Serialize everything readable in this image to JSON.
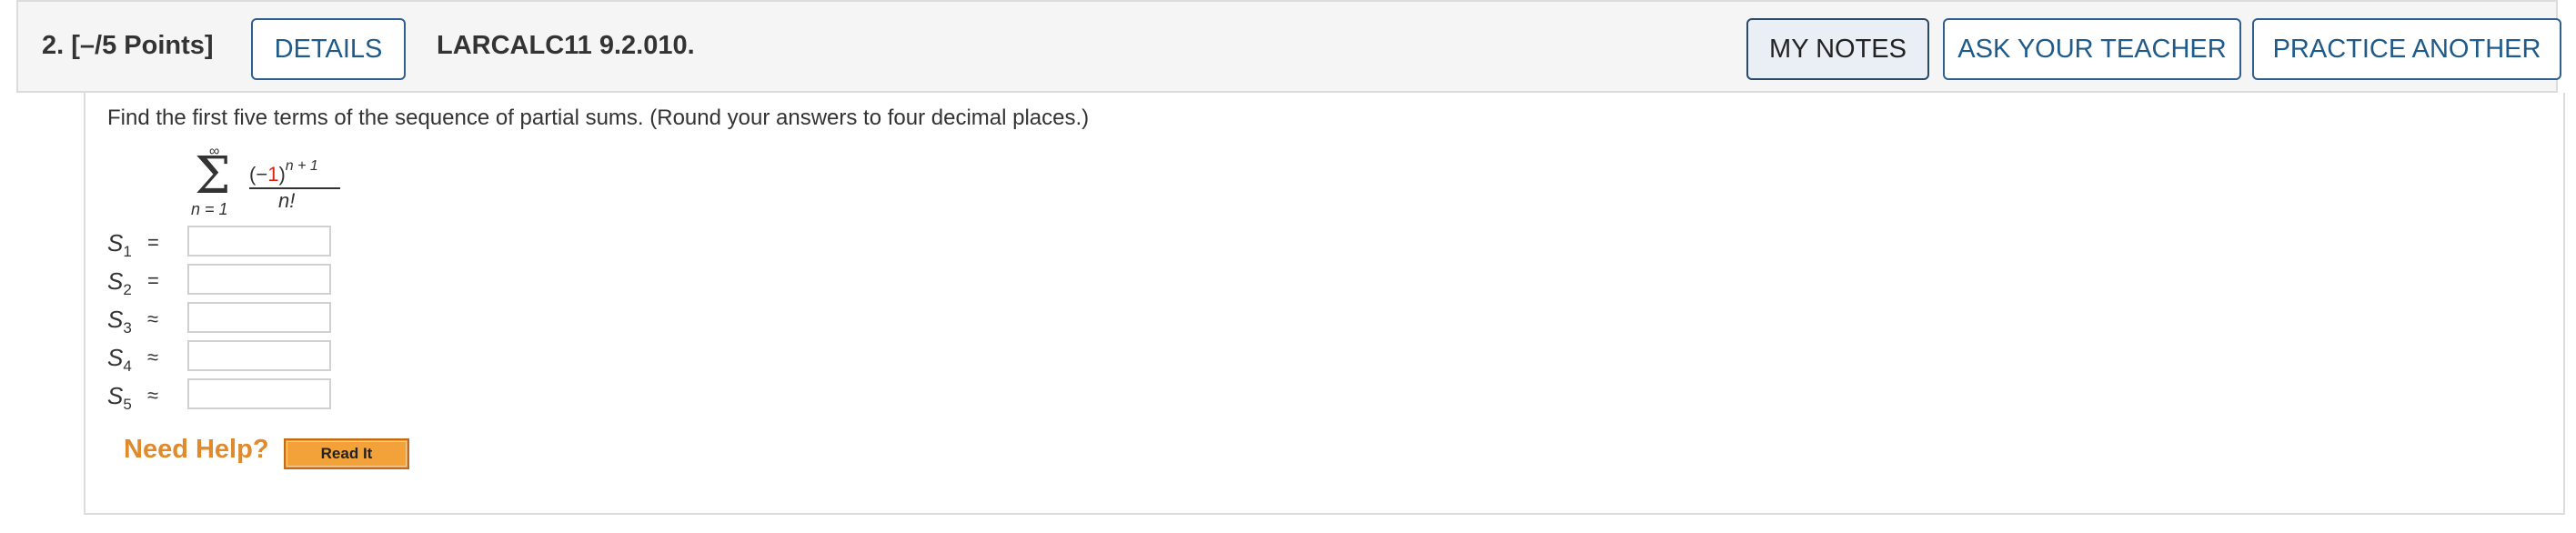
{
  "question": {
    "number_points": "2.  [–/5 Points]",
    "details_label": "DETAILS",
    "code": "LARCALC11 9.2.010."
  },
  "header_buttons": {
    "my_notes": "MY NOTES",
    "ask_teacher": "ASK YOUR TEACHER",
    "practice_another": "PRACTICE ANOTHER"
  },
  "problem": {
    "prompt": "Find the first five terms of the sequence of partial sums. (Round your answers to four decimal places.)",
    "sum_upper": "∞",
    "sum_lower": "n = 1",
    "numerator_pre": "(−",
    "numerator_red": "1",
    "numerator_post": ")",
    "exponent": "n + 1",
    "denominator": "n!"
  },
  "partial_sums": [
    {
      "label": "S",
      "sub": "1",
      "relation": "=",
      "value": ""
    },
    {
      "label": "S",
      "sub": "2",
      "relation": "=",
      "value": ""
    },
    {
      "label": "S",
      "sub": "3",
      "relation": "≈",
      "value": ""
    },
    {
      "label": "S",
      "sub": "4",
      "relation": "≈",
      "value": ""
    },
    {
      "label": "S",
      "sub": "5",
      "relation": "≈",
      "value": ""
    }
  ],
  "help": {
    "need_help": "Need Help?",
    "read_it": "Read It"
  }
}
